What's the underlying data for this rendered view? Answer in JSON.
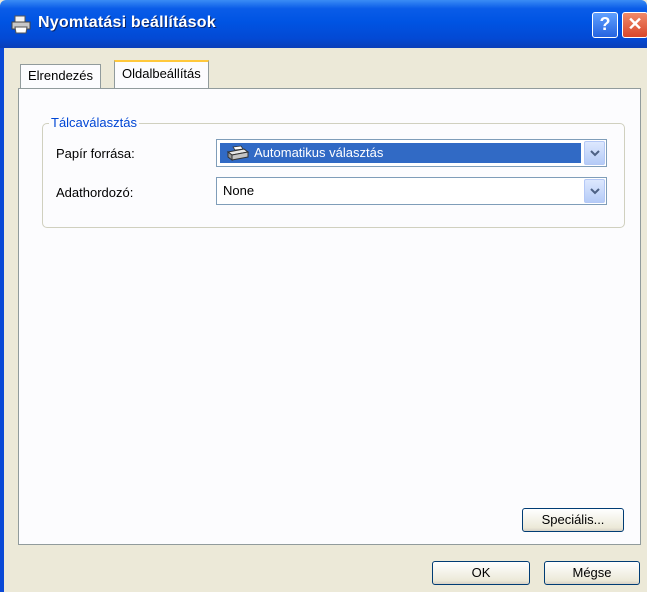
{
  "window": {
    "title": "Nyomtatási beállítások",
    "help_label": "?",
    "close_label": "✕"
  },
  "tabs": [
    {
      "label": "Elrendezés",
      "active": false
    },
    {
      "label": "Oldalbeállítás",
      "active": true
    }
  ],
  "tray_group": {
    "legend": "Tálcaválasztás",
    "paper_source": {
      "label": "Papír forrása:",
      "value": "Automatikus választás",
      "icon": "printer-icon"
    },
    "media": {
      "label": "Adathordozó:",
      "value": "None"
    }
  },
  "buttons": {
    "advanced": "Speciális...",
    "ok": "OK",
    "cancel": "Mégse"
  },
  "colors": {
    "titlebar": "#0054e3",
    "selection": "#316ac5",
    "legend": "#0046d5",
    "face": "#ECE9D8"
  }
}
